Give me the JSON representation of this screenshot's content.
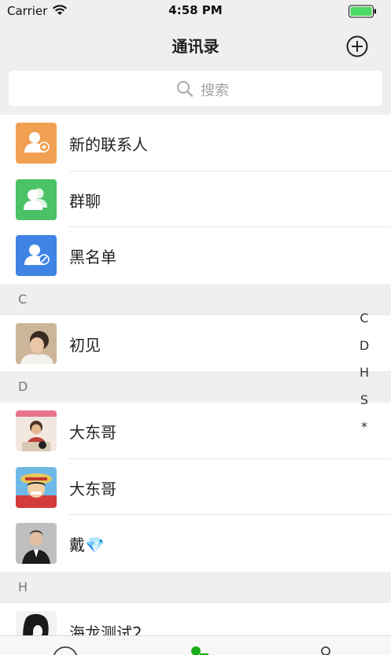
{
  "status_bar": {
    "carrier": "Carrier",
    "time": "4:58 PM"
  },
  "nav": {
    "title": "通讯录"
  },
  "search": {
    "placeholder": "搜索"
  },
  "fixed_items": [
    {
      "label": "新的联系人",
      "icon": "add-contact-icon",
      "color": "#f0a050"
    },
    {
      "label": "群聊",
      "icon": "group-chat-icon",
      "color": "#4cc267"
    },
    {
      "label": "黑名单",
      "icon": "blacklist-icon",
      "color": "#3f84e5"
    }
  ],
  "sections": [
    {
      "letter": "C",
      "contacts": [
        {
          "name": "初见"
        }
      ]
    },
    {
      "letter": "D",
      "contacts": [
        {
          "name": "大东哥"
        },
        {
          "name": "大东哥"
        },
        {
          "name": "戴💎"
        }
      ]
    },
    {
      "letter": "H",
      "contacts": [
        {
          "name": "海龙测试2"
        }
      ]
    }
  ],
  "index_letters": [
    "C",
    "D",
    "H",
    "S",
    "*"
  ],
  "colors": {
    "background": "#efefef",
    "battery": "#4cd964",
    "tab_active": "#1aad19"
  }
}
